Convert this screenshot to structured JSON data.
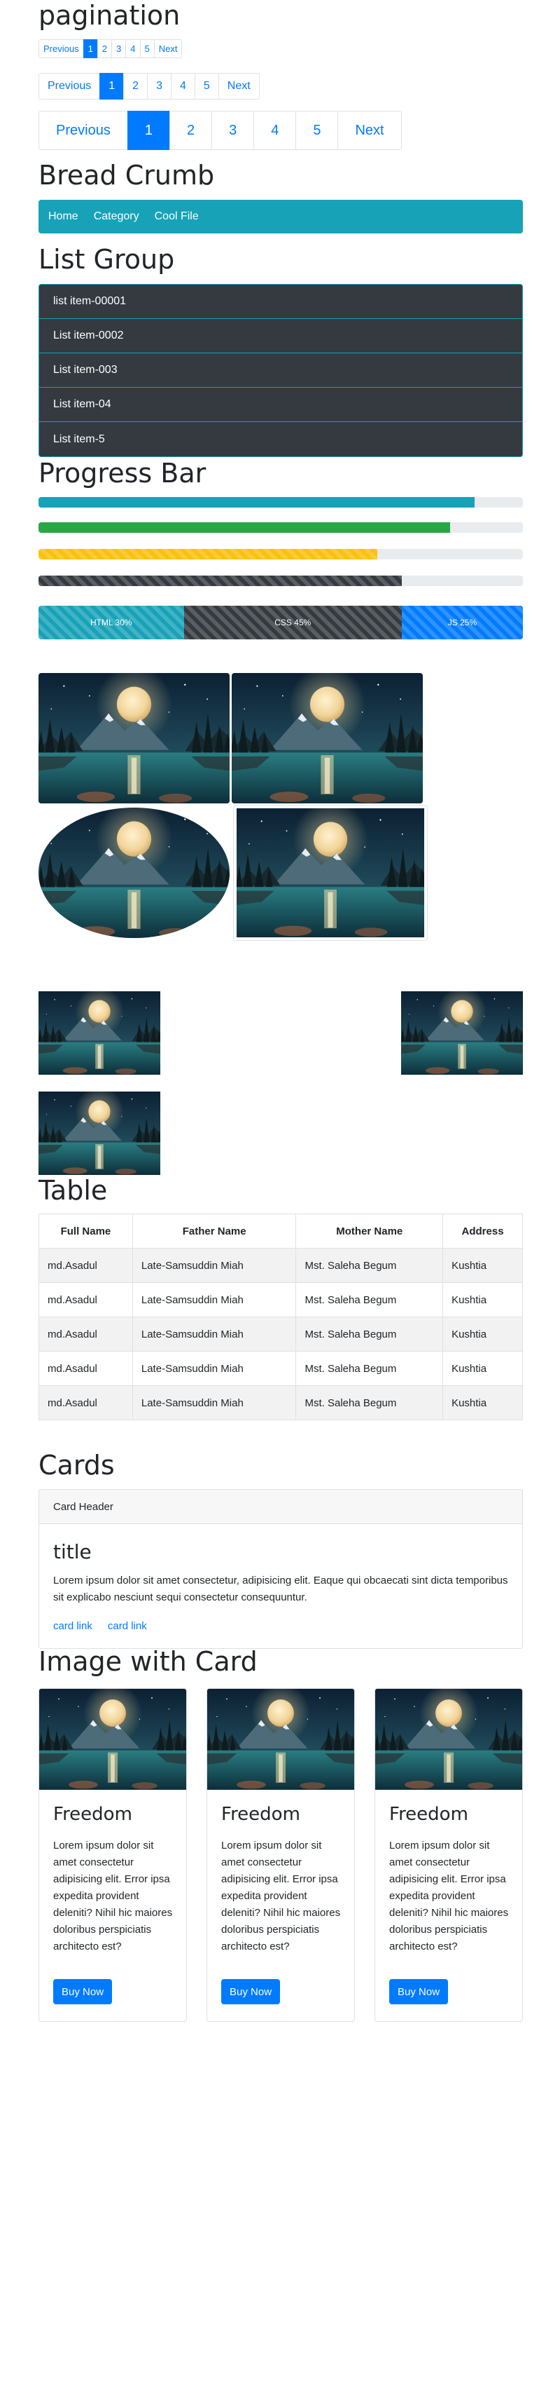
{
  "pagination": {
    "title": "pagination",
    "small": [
      "Previous",
      "1",
      "2",
      "3",
      "4",
      "5",
      "Next"
    ],
    "medium": [
      "Previous",
      "1",
      "2",
      "3",
      "4",
      "5",
      "Next"
    ],
    "large": [
      "Previous",
      "1",
      "2",
      "3",
      "4",
      "5",
      "Next"
    ],
    "active_index": 1,
    "accent": "#007bff"
  },
  "breadcrumb": {
    "title": "Bread Crumb",
    "items": [
      "Home",
      "Category",
      "Cool File"
    ],
    "bg": "#17a2b8"
  },
  "list_group": {
    "title": "List Group",
    "items": [
      "list item-00001",
      "List item-0002",
      "List item-003",
      "List item-04",
      "List item-5"
    ]
  },
  "progress": {
    "title": "Progress Bar",
    "bars": [
      {
        "value": 0.9,
        "color": "#17a2b8",
        "striped": false
      },
      {
        "value": 0.85,
        "color": "#28a745",
        "striped": false
      },
      {
        "value": 0.7,
        "color": "#ffc107",
        "striped": true
      },
      {
        "value": 0.75,
        "color": "#343a40",
        "striped": true
      }
    ],
    "stacked": [
      {
        "label": "HTML 30%",
        "value": 0.3,
        "color": "#17a2b8"
      },
      {
        "label": "CSS 45%",
        "value": 0.45,
        "color": "#343a40"
      },
      {
        "label": "JS 25%",
        "value": 0.25,
        "color": "#007bff"
      }
    ]
  },
  "table": {
    "title": "Table",
    "headers": [
      "Full Name",
      "Father Name",
      "Mother Name",
      "Address"
    ],
    "rows": [
      [
        "md.Asadul",
        "Late-Samsuddin Miah",
        "Mst. Saleha Begum",
        "Kushtia"
      ],
      [
        "md.Asadul",
        "Late-Samsuddin Miah",
        "Mst. Saleha Begum",
        "Kushtia"
      ],
      [
        "md.Asadul",
        "Late-Samsuddin Miah",
        "Mst. Saleha Begum",
        "Kushtia"
      ],
      [
        "md.Asadul",
        "Late-Samsuddin Miah",
        "Mst. Saleha Begum",
        "Kushtia"
      ],
      [
        "md.Asadul",
        "Late-Samsuddin Miah",
        "Mst. Saleha Begum",
        "Kushtia"
      ]
    ]
  },
  "cards": {
    "title": "Cards",
    "header": "Card Header",
    "card_title": "title",
    "text": "Lorem ipsum dolor sit amet consectetur, adipisicing elit. Eaque qui obcaecati sint dicta temporibus sit explicabo nesciunt sequi consectetur consequuntur.",
    "links": [
      "card link",
      "card link"
    ]
  },
  "image_cards": {
    "title": "Image with Card",
    "items": [
      {
        "title": "Freedom",
        "text": "Lorem ipsum dolor sit amet consectetur adipisicing elit. Error ipsa expedita provident deleniti? Nihil hic maiores doloribus perspiciatis architecto est?",
        "button": "Buy Now"
      },
      {
        "title": "Freedom",
        "text": "Lorem ipsum dolor sit amet consectetur adipisicing elit. Error ipsa expedita provident deleniti? Nihil hic maiores doloribus perspiciatis architecto est?",
        "button": "Buy Now"
      },
      {
        "title": "Freedom",
        "text": "Lorem ipsum dolor sit amet consectetur adipisicing elit. Error ipsa expedita provident deleniti? Nihil hic maiores doloribus perspiciatis architecto est?",
        "button": "Buy Now"
      }
    ]
  }
}
